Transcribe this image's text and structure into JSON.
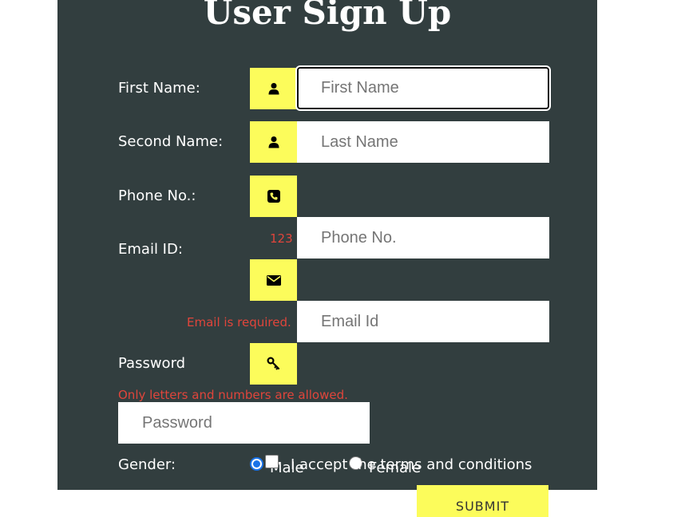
{
  "form": {
    "title": "User Sign Up",
    "first_name": {
      "label": "First Name:",
      "placeholder": "First Name",
      "icon": "user-icon"
    },
    "second_name": {
      "label": "Second Name:",
      "placeholder": "Last Name",
      "icon": "user-icon"
    },
    "phone": {
      "label": "Phone No.:",
      "placeholder": "Phone No.",
      "icon": "phone-icon",
      "hint": "123"
    },
    "email": {
      "label": "Email ID:",
      "placeholder": "Email Id",
      "icon": "envelope-icon",
      "error": "Email is required."
    },
    "password": {
      "label": "Password",
      "placeholder": "Password",
      "icon": "key-icon",
      "error": "Only letters and numbers are allowed."
    },
    "gender": {
      "label": "Gender:",
      "options": [
        {
          "label": "Male",
          "selected": true
        },
        {
          "label": "Female",
          "selected": false
        }
      ]
    },
    "terms": {
      "label": "I accept the terms and conditions",
      "checked": false
    },
    "submit_label": "SUBMIT"
  },
  "colors": {
    "panel": "#323e3f",
    "icon_box": "#fcfc5b",
    "error_text": "#e0453b",
    "radio_selected": "#1a73e8"
  }
}
